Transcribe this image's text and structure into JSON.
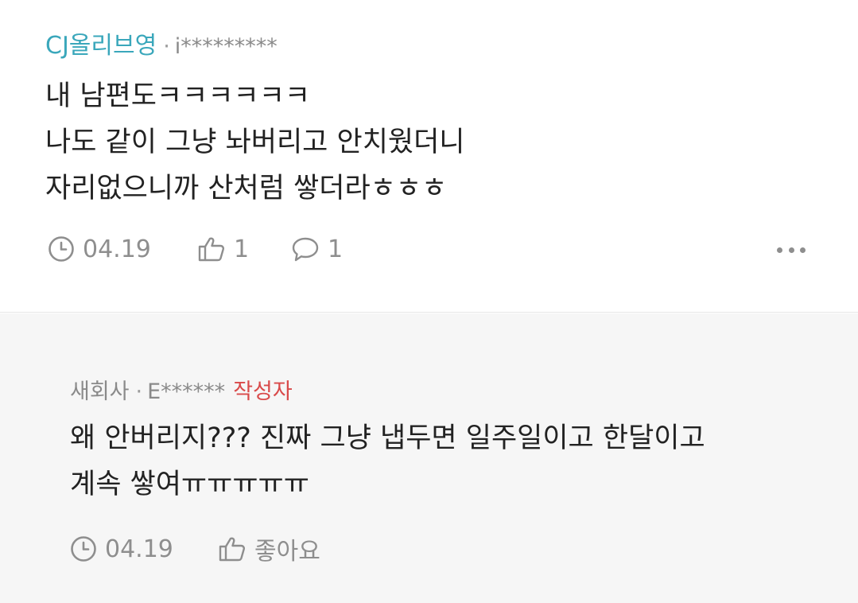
{
  "comments": [
    {
      "company": "CJ올리브영",
      "separator": "·",
      "user": "i*********",
      "lines": [
        "내 남편도ㅋㅋㅋㅋㅋㅋ",
        "나도 같이 그냥 놔버리고 안치웠더니",
        "자리없으니까 산처럼 쌓더라ㅎㅎㅎ"
      ],
      "date": "04.19",
      "likes": "1",
      "replies": "1"
    },
    {
      "company": "새회사",
      "separator": "·",
      "user": "E******",
      "author_badge": "작성자",
      "lines": [
        "왜 안버리지??? 진짜 그냥 냅두면 일주일이고 한달이고",
        "계속 쌓여ㅠㅠㅠㅠㅠ"
      ],
      "date": "04.19",
      "like_label": "좋아요"
    }
  ],
  "icons": {
    "clock": "clock-icon",
    "like": "thumbs-up-icon",
    "reply": "speech-bubble-icon",
    "more": "more-dots-icon"
  },
  "colors": {
    "brand_company": "#3aa7bb",
    "author_badge": "#d94a4a",
    "meta_gray": "#8e8e8e",
    "reply_background": "#f6f6f6"
  }
}
